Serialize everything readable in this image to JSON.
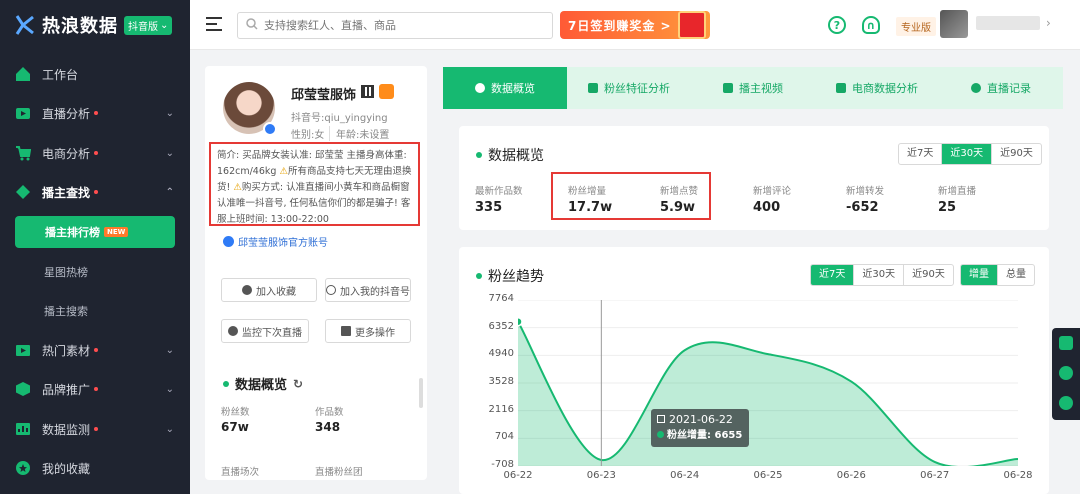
{
  "app": {
    "name": "热浪数据",
    "badge": "抖音版"
  },
  "sidebar": {
    "items": [
      {
        "label": "工作台",
        "dot": false
      },
      {
        "label": "直播分析",
        "dot": true
      },
      {
        "label": "电商分析",
        "dot": true
      },
      {
        "label": "播主查找",
        "dot": true
      },
      {
        "label": "热门素材",
        "dot": true
      },
      {
        "label": "品牌推广",
        "dot": true
      },
      {
        "label": "数据监测",
        "dot": true
      },
      {
        "label": "我的收藏",
        "dot": false
      }
    ],
    "subitems": [
      {
        "label": "播主排行榜",
        "tag": "NEW"
      },
      {
        "label": "星图热榜"
      },
      {
        "label": "播主搜索"
      }
    ]
  },
  "topbar": {
    "search_placeholder": "支持搜索红人、直播、商品",
    "promo": "7日签到赚奖金 >",
    "edition": "专业版"
  },
  "profile": {
    "name": "邱莹莹服饰",
    "douyin_id": "抖音号:qiu_yingying",
    "gender": "性别:女",
    "age": "年龄:未设置",
    "bio_1": "简介: 买品牌女装认准: 邱莹莹 主播身高体重: 162cm/46kg",
    "bio_2": "所有商品支持七天无理由退换货!",
    "bio_3": "购买方式: 认准直播间小黄车和商品橱窗 认准唯一抖音号, 任何私信你们的都是骗子! 客服上班时间: 13:00-22:00",
    "official": "邱莹莹服饰官方账号",
    "buttons": [
      "加入收藏",
      "加入我的抖音号",
      "监控下次直播",
      "更多操作"
    ],
    "overview_title": "数据概览",
    "stats": [
      {
        "label": "粉丝数",
        "value": "67w"
      },
      {
        "label": "作品数",
        "value": "348"
      },
      {
        "label": "直播场次",
        "value": ""
      },
      {
        "label": "直播粉丝团",
        "value": ""
      }
    ]
  },
  "tabs": [
    "数据概览",
    "粉丝特征分析",
    "播主视频",
    "电商数据分析",
    "直播记录"
  ],
  "overview": {
    "title": "数据概览",
    "ranges": [
      "近7天",
      "近30天",
      "近90天"
    ],
    "metrics": [
      {
        "label": "最新作品数",
        "value": "335"
      },
      {
        "label": "粉丝增量",
        "value": "17.7w"
      },
      {
        "label": "新增点赞",
        "value": "5.9w"
      },
      {
        "label": "新增评论",
        "value": "400"
      },
      {
        "label": "新增转发",
        "value": "-652"
      },
      {
        "label": "新增直播",
        "value": "25"
      }
    ]
  },
  "trend": {
    "title": "粉丝趋势",
    "ranges": [
      "近7天",
      "近30天",
      "近90天"
    ],
    "modes": [
      "增量",
      "总量"
    ],
    "tooltip": {
      "date": "2021-06-22",
      "label": "粉丝增量: ",
      "value": "6655"
    }
  },
  "chart_data": {
    "type": "area",
    "title": "粉丝趋势",
    "x": [
      "06-22",
      "06-23",
      "06-24",
      "06-25",
      "06-26",
      "06-27",
      "06-28"
    ],
    "yticks": [
      7764,
      6352,
      4940,
      3528,
      2116,
      704,
      -708
    ],
    "ylim": [
      -708,
      7764
    ],
    "series": [
      {
        "name": "粉丝增量",
        "values": [
          6655,
          -400,
          5200,
          5000,
          3600,
          -500,
          -350
        ]
      }
    ],
    "color": "#16b971"
  }
}
